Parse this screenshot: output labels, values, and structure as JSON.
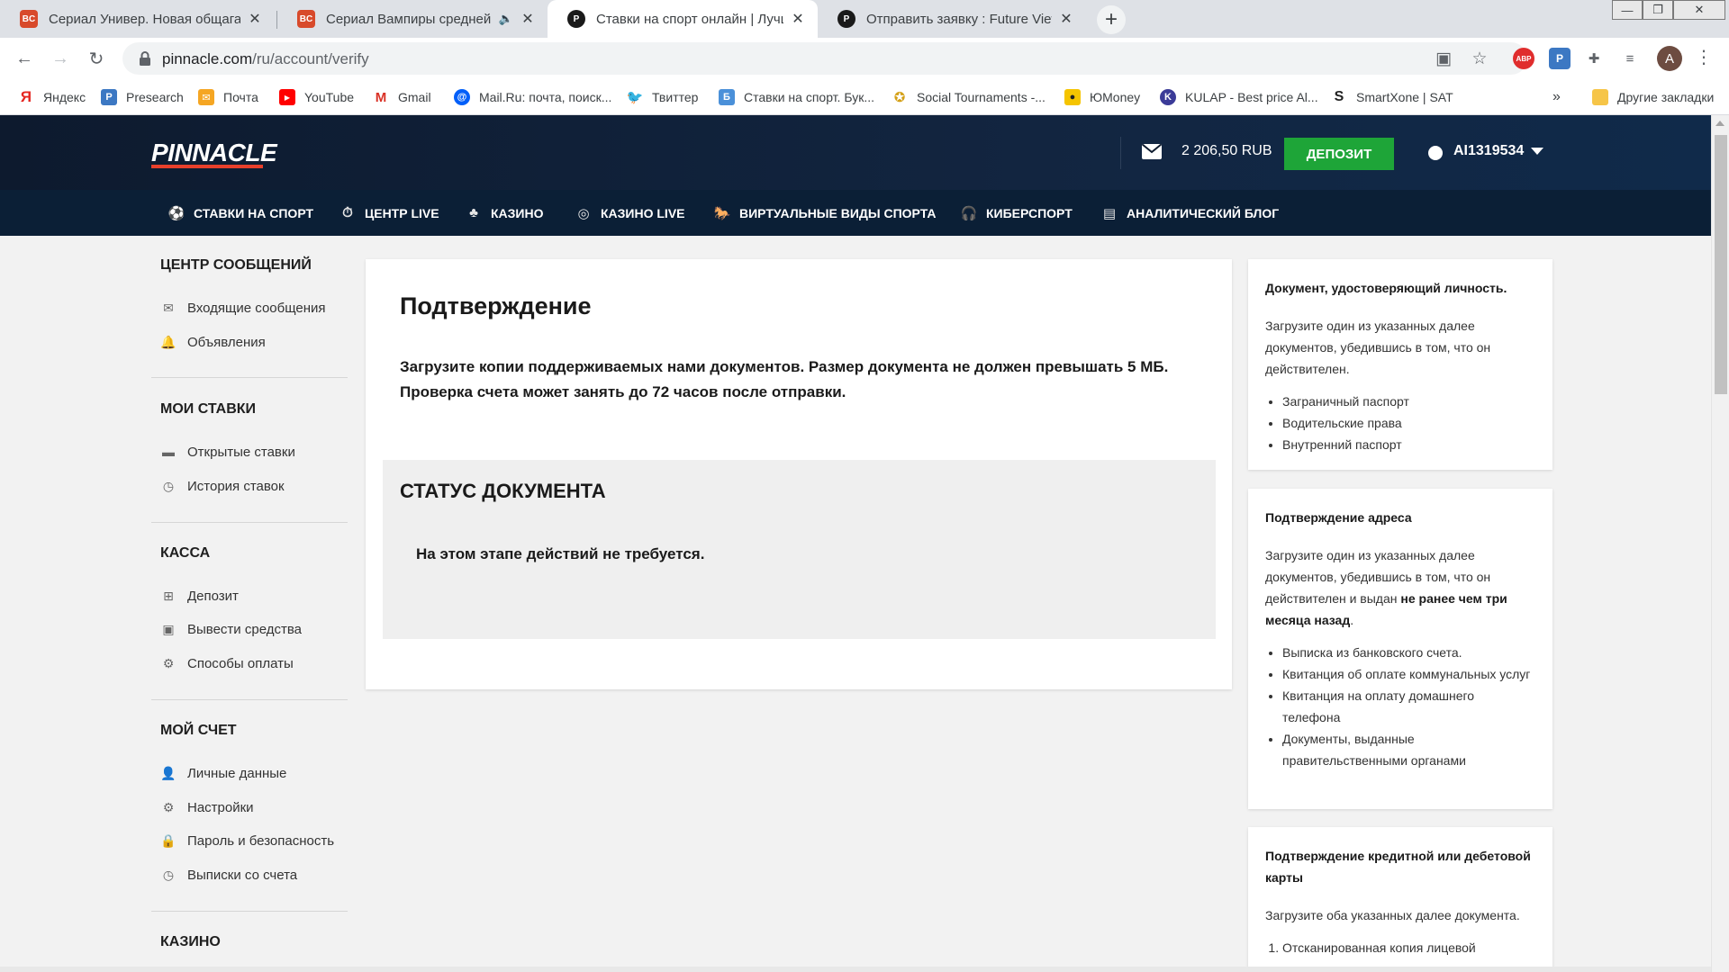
{
  "browser": {
    "tabs": [
      {
        "title": "Сериал Универ. Новая общага смотреть",
        "icon": "bc-favicon",
        "active": false
      },
      {
        "title": "Сериал Вампиры средней полосы",
        "icon": "bc-favicon",
        "active": false,
        "audio": "🔈"
      },
      {
        "title": "Ставки на спорт онлайн | Лучшие",
        "icon": "pinnacle-favicon",
        "active": true
      },
      {
        "title": "Отправить заявку : Future View",
        "icon": "pinnacle-favicon",
        "active": false
      }
    ],
    "url_host": "pinnacle.com",
    "url_path": "/ru/account/verify",
    "profile_initial": "A",
    "bookmarks": [
      {
        "label": "Яндекс",
        "icon": "yandex-icon",
        "color": "#e52620"
      },
      {
        "label": "Presearch",
        "icon": "presearch-icon",
        "color": "#3c78c3"
      },
      {
        "label": "Почта",
        "icon": "mail-icon",
        "color": "#f5a623"
      },
      {
        "label": "YouTube",
        "icon": "youtube-icon",
        "color": "#ff0000"
      },
      {
        "label": "Gmail",
        "icon": "gmail-icon",
        "color": "#d93025"
      },
      {
        "label": "Mail.Ru: почта, поиск...",
        "icon": "mailru-icon",
        "color": "#005ff9"
      },
      {
        "label": "Твиттер",
        "icon": "twitter-icon",
        "color": "#1da1f2"
      },
      {
        "label": "Ставки на спорт. Бук...",
        "icon": "bet-icon",
        "color": "#4a90d9"
      },
      {
        "label": "Social Tournaments -...",
        "icon": "medal-icon",
        "color": "#d4a017"
      },
      {
        "label": "ЮMoney",
        "icon": "yoomoney-icon",
        "color": "#f5c400"
      },
      {
        "label": "KULAP - Best price Al...",
        "icon": "kulap-icon",
        "color": "#3b3b98"
      },
      {
        "label": "SmartXone | SAT",
        "icon": "smartxone-icon",
        "color": "#222222"
      }
    ],
    "other_bookmarks": "Другие закладки"
  },
  "site": {
    "logo": "PINNACLE",
    "balance": "2 206,50 RUB",
    "deposit_label": "ДЕПОЗИТ",
    "username": "AI1319534",
    "nav": [
      {
        "label": "СТАВКИ НА СПОРТ",
        "icon": "soccer-ball-icon"
      },
      {
        "label": "ЦЕНТР LIVE",
        "icon": "stopwatch-icon"
      },
      {
        "label": "КАЗИНО",
        "icon": "casino-chips-icon"
      },
      {
        "label": "КАЗИНО LIVE",
        "icon": "roulette-icon"
      },
      {
        "label": "ВИРТУАЛЬНЫЕ ВИДЫ СПОРТА",
        "icon": "virtual-sports-icon"
      },
      {
        "label": "КИБЕРСПОРТ",
        "icon": "headset-icon"
      },
      {
        "label": "АНАЛИТИЧЕСКИЙ БЛОГ",
        "icon": "blog-icon"
      }
    ]
  },
  "sidebar": {
    "sections": [
      {
        "title": "ЦЕНТР СООБЩЕНИЙ",
        "items": [
          {
            "label": "Входящие сообщения",
            "icon": "envelope-icon"
          },
          {
            "label": "Объявления",
            "icon": "bell-icon"
          }
        ]
      },
      {
        "title": "МОИ СТАВКИ",
        "items": [
          {
            "label": "Открытые ставки",
            "icon": "ticket-icon"
          },
          {
            "label": "История ставок",
            "icon": "history-icon"
          }
        ]
      },
      {
        "title": "КАССА",
        "items": [
          {
            "label": "Депозит",
            "icon": "deposit-icon"
          },
          {
            "label": "Вывести средства",
            "icon": "withdraw-icon"
          },
          {
            "label": "Способы оплаты",
            "icon": "payment-settings-icon"
          }
        ]
      },
      {
        "title": "МОЙ СЧЕТ",
        "items": [
          {
            "label": "Личные данные",
            "icon": "user-icon"
          },
          {
            "label": "Настройки",
            "icon": "gear-icon"
          },
          {
            "label": "Пароль и безопасность",
            "icon": "lock-icon"
          },
          {
            "label": "Выписки со счета",
            "icon": "statement-icon"
          }
        ]
      },
      {
        "title": "КАЗИНО",
        "items": []
      }
    ]
  },
  "main": {
    "title": "Подтверждение",
    "intro": "Загрузите копии поддерживаемых нами документов. Размер документа не должен превышать 5 МБ. Проверка счета может занять до 72 часов после отправки.",
    "status_title": "СТАТУС ДОКУМЕНТА",
    "status_text": "На этом этапе действий не требуется."
  },
  "info": {
    "identity": {
      "title": "Документ, удостоверяющий личность.",
      "text": "Загрузите один из указанных далее документов, убедившись в том, что он действителен.",
      "items": [
        "Заграничный паспорт",
        "Водительские права",
        "Внутренний паспорт"
      ]
    },
    "address": {
      "title": "Подтверждение адреса",
      "text_before": "Загрузите один из указанных далее документов, убедившись в том, что он действителен и выдан ",
      "text_bold": "не ранее чем три месяца назад",
      "text_after": ".",
      "items": [
        "Выписка из банковского счета.",
        "Квитанция об оплате коммунальных услуг",
        "Квитанция на оплату домашнего телефона",
        "Документы, выданные правительственными органами"
      ]
    },
    "card": {
      "title": "Подтверждение кредитной или дебетовой карты",
      "text": "Загрузите оба указанных далее документа.",
      "items": [
        "Отсканированная копия лицевой"
      ]
    }
  },
  "colors": {
    "header_bg": "#0d1a2e",
    "nav_bg": "#0b1f36",
    "deposit": "#1ea538",
    "logo_accent": "#e8402b"
  }
}
